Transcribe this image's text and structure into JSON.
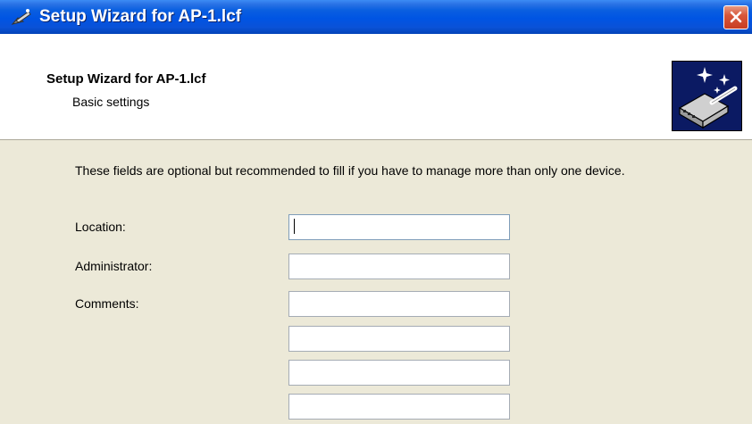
{
  "window": {
    "title": "Setup Wizard for AP-1.lcf",
    "icons": {
      "app": "wizard-wand-icon",
      "close": "close-x-icon"
    },
    "colors": {
      "titlebar": "#0054e3",
      "close_button": "#d8573a",
      "face": "#ece9d8",
      "logo_bg": "#0b1a63"
    }
  },
  "header": {
    "title": "Setup Wizard for AP-1.lcf",
    "subtitle": "Basic settings",
    "logo_icon": "access-point-wizard-icon"
  },
  "body": {
    "intro": "These fields are optional but recommended to fill if you have to manage more than only one device.",
    "fields": {
      "location": {
        "label": "Location:",
        "value": ""
      },
      "administrator": {
        "label": "Administrator:",
        "value": ""
      },
      "comments": {
        "label": "Comments:",
        "lines": [
          "",
          "",
          "",
          ""
        ]
      }
    }
  }
}
